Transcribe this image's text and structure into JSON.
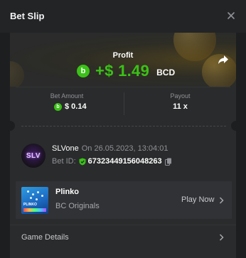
{
  "header": {
    "title": "Bet Slip"
  },
  "profit": {
    "label": "Profit",
    "amount": "+$ 1.49",
    "currency": "BCD"
  },
  "bet_amount": {
    "label": "Bet Amount",
    "value": "$ 0.14"
  },
  "payout": {
    "label": "Payout",
    "value": "11 x"
  },
  "user": {
    "avatar_text": "SLV",
    "name": "SLVone",
    "date": "On 26.05.2023, 13:04:01"
  },
  "bet_id": {
    "label": "Bet ID:",
    "value": "67323449156048263"
  },
  "game": {
    "name": "Plinko",
    "provider": "BC Originals",
    "play_label": "Play Now",
    "thumb_text": "PLINKO"
  },
  "game_details": {
    "label": "Game Details"
  },
  "colors": {
    "accent_green": "#3bc117",
    "background": "#1d1e20",
    "panel": "#2a2b2c"
  },
  "icons": {
    "close": "close-icon",
    "share": "share-icon",
    "currency": "bcd-coin-icon",
    "shield": "shield-icon",
    "copy": "copy-icon",
    "chevron": "chevron-right-icon"
  }
}
